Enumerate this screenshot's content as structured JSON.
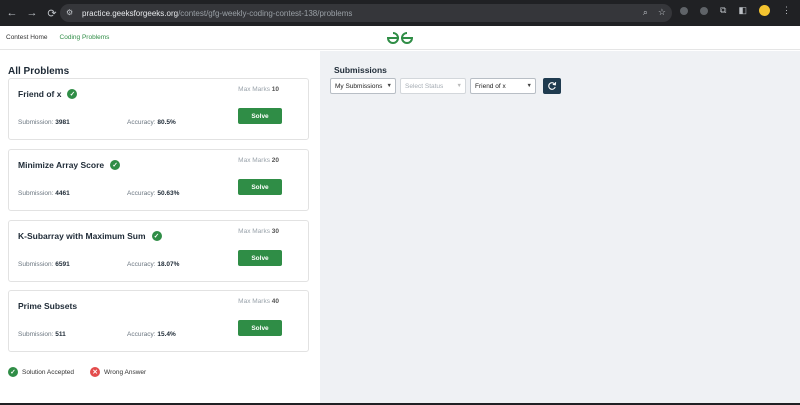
{
  "browser": {
    "url_host": "practice.geeksforgeeks.org",
    "url_path": "/contest/gfg-weekly-coding-contest-138/problems"
  },
  "header": {
    "nav": [
      {
        "label": "Contest Home"
      },
      {
        "label": "Coding Problems"
      }
    ],
    "colors": {
      "brand": "#2f8d46"
    }
  },
  "problems": {
    "title": "All Problems",
    "max_marks_label": "Max Marks",
    "submission_label": "Submission:",
    "accuracy_label": "Accuracy:",
    "solve_label": "Solve",
    "items": [
      {
        "name": "Friend of x",
        "max_marks": "10",
        "submissions": "3981",
        "accuracy": "80.5%"
      },
      {
        "name": "Minimize Array Score",
        "max_marks": "20",
        "submissions": "4461",
        "accuracy": "50.63%"
      },
      {
        "name": "K-Subarray with Maximum Sum",
        "max_marks": "30",
        "submissions": "6591",
        "accuracy": "18.07%"
      },
      {
        "name": "Prime Subsets",
        "max_marks": "40",
        "submissions": "511",
        "accuracy": "15.4%"
      }
    ],
    "legend": {
      "accepted": "Solution Accepted",
      "wrong": "Wrong Answer"
    }
  },
  "submissions": {
    "title": "Submissions",
    "filter_scope": "My Submissions",
    "filter_status_placeholder": "Select Status",
    "filter_problem": "Friend of x"
  }
}
